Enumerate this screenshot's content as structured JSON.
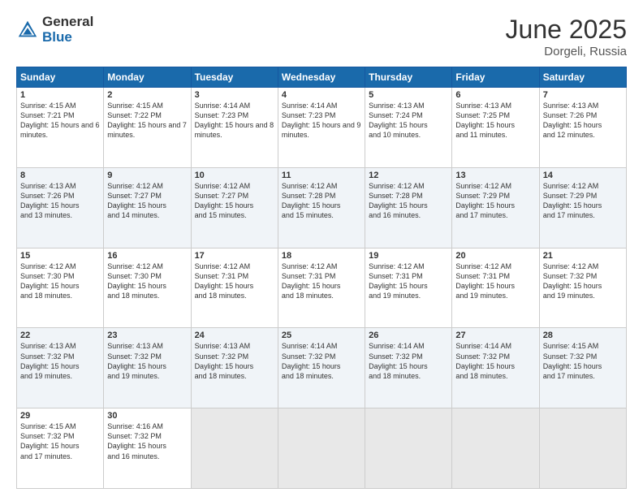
{
  "logo": {
    "general": "General",
    "blue": "Blue"
  },
  "title": {
    "month": "June 2025",
    "location": "Dorgeli, Russia"
  },
  "days_of_week": [
    "Sunday",
    "Monday",
    "Tuesday",
    "Wednesday",
    "Thursday",
    "Friday",
    "Saturday"
  ],
  "weeks": [
    [
      {
        "day": "1",
        "sunrise": "4:15 AM",
        "sunset": "7:21 PM",
        "daylight": "15 hours and 6 minutes."
      },
      {
        "day": "2",
        "sunrise": "4:15 AM",
        "sunset": "7:22 PM",
        "daylight": "15 hours and 7 minutes."
      },
      {
        "day": "3",
        "sunrise": "4:14 AM",
        "sunset": "7:23 PM",
        "daylight": "15 hours and 8 minutes."
      },
      {
        "day": "4",
        "sunrise": "4:14 AM",
        "sunset": "7:23 PM",
        "daylight": "15 hours and 9 minutes."
      },
      {
        "day": "5",
        "sunrise": "4:13 AM",
        "sunset": "7:24 PM",
        "daylight": "15 hours and 10 minutes."
      },
      {
        "day": "6",
        "sunrise": "4:13 AM",
        "sunset": "7:25 PM",
        "daylight": "15 hours and 11 minutes."
      },
      {
        "day": "7",
        "sunrise": "4:13 AM",
        "sunset": "7:26 PM",
        "daylight": "15 hours and 12 minutes."
      }
    ],
    [
      {
        "day": "8",
        "sunrise": "4:13 AM",
        "sunset": "7:26 PM",
        "daylight": "15 hours and 13 minutes."
      },
      {
        "day": "9",
        "sunrise": "4:12 AM",
        "sunset": "7:27 PM",
        "daylight": "15 hours and 14 minutes."
      },
      {
        "day": "10",
        "sunrise": "4:12 AM",
        "sunset": "7:27 PM",
        "daylight": "15 hours and 15 minutes."
      },
      {
        "day": "11",
        "sunrise": "4:12 AM",
        "sunset": "7:28 PM",
        "daylight": "15 hours and 15 minutes."
      },
      {
        "day": "12",
        "sunrise": "4:12 AM",
        "sunset": "7:28 PM",
        "daylight": "15 hours and 16 minutes."
      },
      {
        "day": "13",
        "sunrise": "4:12 AM",
        "sunset": "7:29 PM",
        "daylight": "15 hours and 17 minutes."
      },
      {
        "day": "14",
        "sunrise": "4:12 AM",
        "sunset": "7:29 PM",
        "daylight": "15 hours and 17 minutes."
      }
    ],
    [
      {
        "day": "15",
        "sunrise": "4:12 AM",
        "sunset": "7:30 PM",
        "daylight": "15 hours and 18 minutes."
      },
      {
        "day": "16",
        "sunrise": "4:12 AM",
        "sunset": "7:30 PM",
        "daylight": "15 hours and 18 minutes."
      },
      {
        "day": "17",
        "sunrise": "4:12 AM",
        "sunset": "7:31 PM",
        "daylight": "15 hours and 18 minutes."
      },
      {
        "day": "18",
        "sunrise": "4:12 AM",
        "sunset": "7:31 PM",
        "daylight": "15 hours and 18 minutes."
      },
      {
        "day": "19",
        "sunrise": "4:12 AM",
        "sunset": "7:31 PM",
        "daylight": "15 hours and 19 minutes."
      },
      {
        "day": "20",
        "sunrise": "4:12 AM",
        "sunset": "7:31 PM",
        "daylight": "15 hours and 19 minutes."
      },
      {
        "day": "21",
        "sunrise": "4:12 AM",
        "sunset": "7:32 PM",
        "daylight": "15 hours and 19 minutes."
      }
    ],
    [
      {
        "day": "22",
        "sunrise": "4:13 AM",
        "sunset": "7:32 PM",
        "daylight": "15 hours and 19 minutes."
      },
      {
        "day": "23",
        "sunrise": "4:13 AM",
        "sunset": "7:32 PM",
        "daylight": "15 hours and 19 minutes."
      },
      {
        "day": "24",
        "sunrise": "4:13 AM",
        "sunset": "7:32 PM",
        "daylight": "15 hours and 18 minutes."
      },
      {
        "day": "25",
        "sunrise": "4:14 AM",
        "sunset": "7:32 PM",
        "daylight": "15 hours and 18 minutes."
      },
      {
        "day": "26",
        "sunrise": "4:14 AM",
        "sunset": "7:32 PM",
        "daylight": "15 hours and 18 minutes."
      },
      {
        "day": "27",
        "sunrise": "4:14 AM",
        "sunset": "7:32 PM",
        "daylight": "15 hours and 18 minutes."
      },
      {
        "day": "28",
        "sunrise": "4:15 AM",
        "sunset": "7:32 PM",
        "daylight": "15 hours and 17 minutes."
      }
    ],
    [
      {
        "day": "29",
        "sunrise": "4:15 AM",
        "sunset": "7:32 PM",
        "daylight": "15 hours and 17 minutes."
      },
      {
        "day": "30",
        "sunrise": "4:16 AM",
        "sunset": "7:32 PM",
        "daylight": "15 hours and 16 minutes."
      },
      null,
      null,
      null,
      null,
      null
    ]
  ]
}
